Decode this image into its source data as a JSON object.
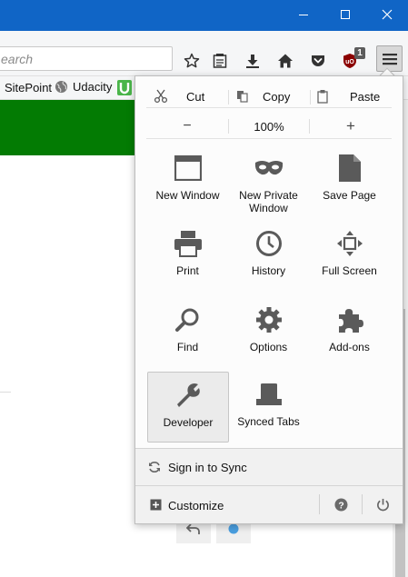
{
  "window": {
    "minimize_icon": "minimize-icon",
    "maximize_icon": "maximize-icon",
    "close_icon": "close-icon"
  },
  "toolbar": {
    "search_placeholder": "earch",
    "icons": [
      "star-icon",
      "reading-list-icon",
      "download-icon",
      "home-icon",
      "pocket-icon",
      "ublock-icon",
      "hamburger-menu-icon"
    ],
    "ublock_badge": "1"
  },
  "bookmarks": {
    "items": [
      {
        "label": "SitePoint",
        "icon": ""
      },
      {
        "label": "Udacity",
        "icon": "globe-icon"
      },
      {
        "label": "",
        "icon": "udemy-icon"
      }
    ]
  },
  "menu": {
    "edit": {
      "cut": "Cut",
      "copy": "Copy",
      "paste": "Paste"
    },
    "zoom": {
      "minus": "−",
      "level": "100%",
      "plus": "+"
    },
    "tiles": [
      {
        "label": "New Window",
        "icon": "window-icon"
      },
      {
        "label": "New Private Window",
        "icon": "private-mask-icon"
      },
      {
        "label": "Save Page",
        "icon": "page-icon"
      },
      {
        "label": "Print",
        "icon": "printer-icon"
      },
      {
        "label": "History",
        "icon": "clock-icon"
      },
      {
        "label": "Full Screen",
        "icon": "fullscreen-icon"
      },
      {
        "label": "Find",
        "icon": "magnifier-icon"
      },
      {
        "label": "Options",
        "icon": "gear-icon"
      },
      {
        "label": "Add-ons",
        "icon": "puzzle-icon"
      },
      {
        "label": "Developer",
        "icon": "wrench-icon"
      },
      {
        "label": "Synced Tabs",
        "icon": "synced-tabs-icon"
      }
    ],
    "sync_label": "Sign in to Sync",
    "customize_label": "Customize"
  },
  "colors": {
    "titlebar": "#1065c6",
    "green_banner": "#037b03",
    "icon_gray": "#5a5a5a",
    "badge_blue": "#4a9fe0"
  }
}
